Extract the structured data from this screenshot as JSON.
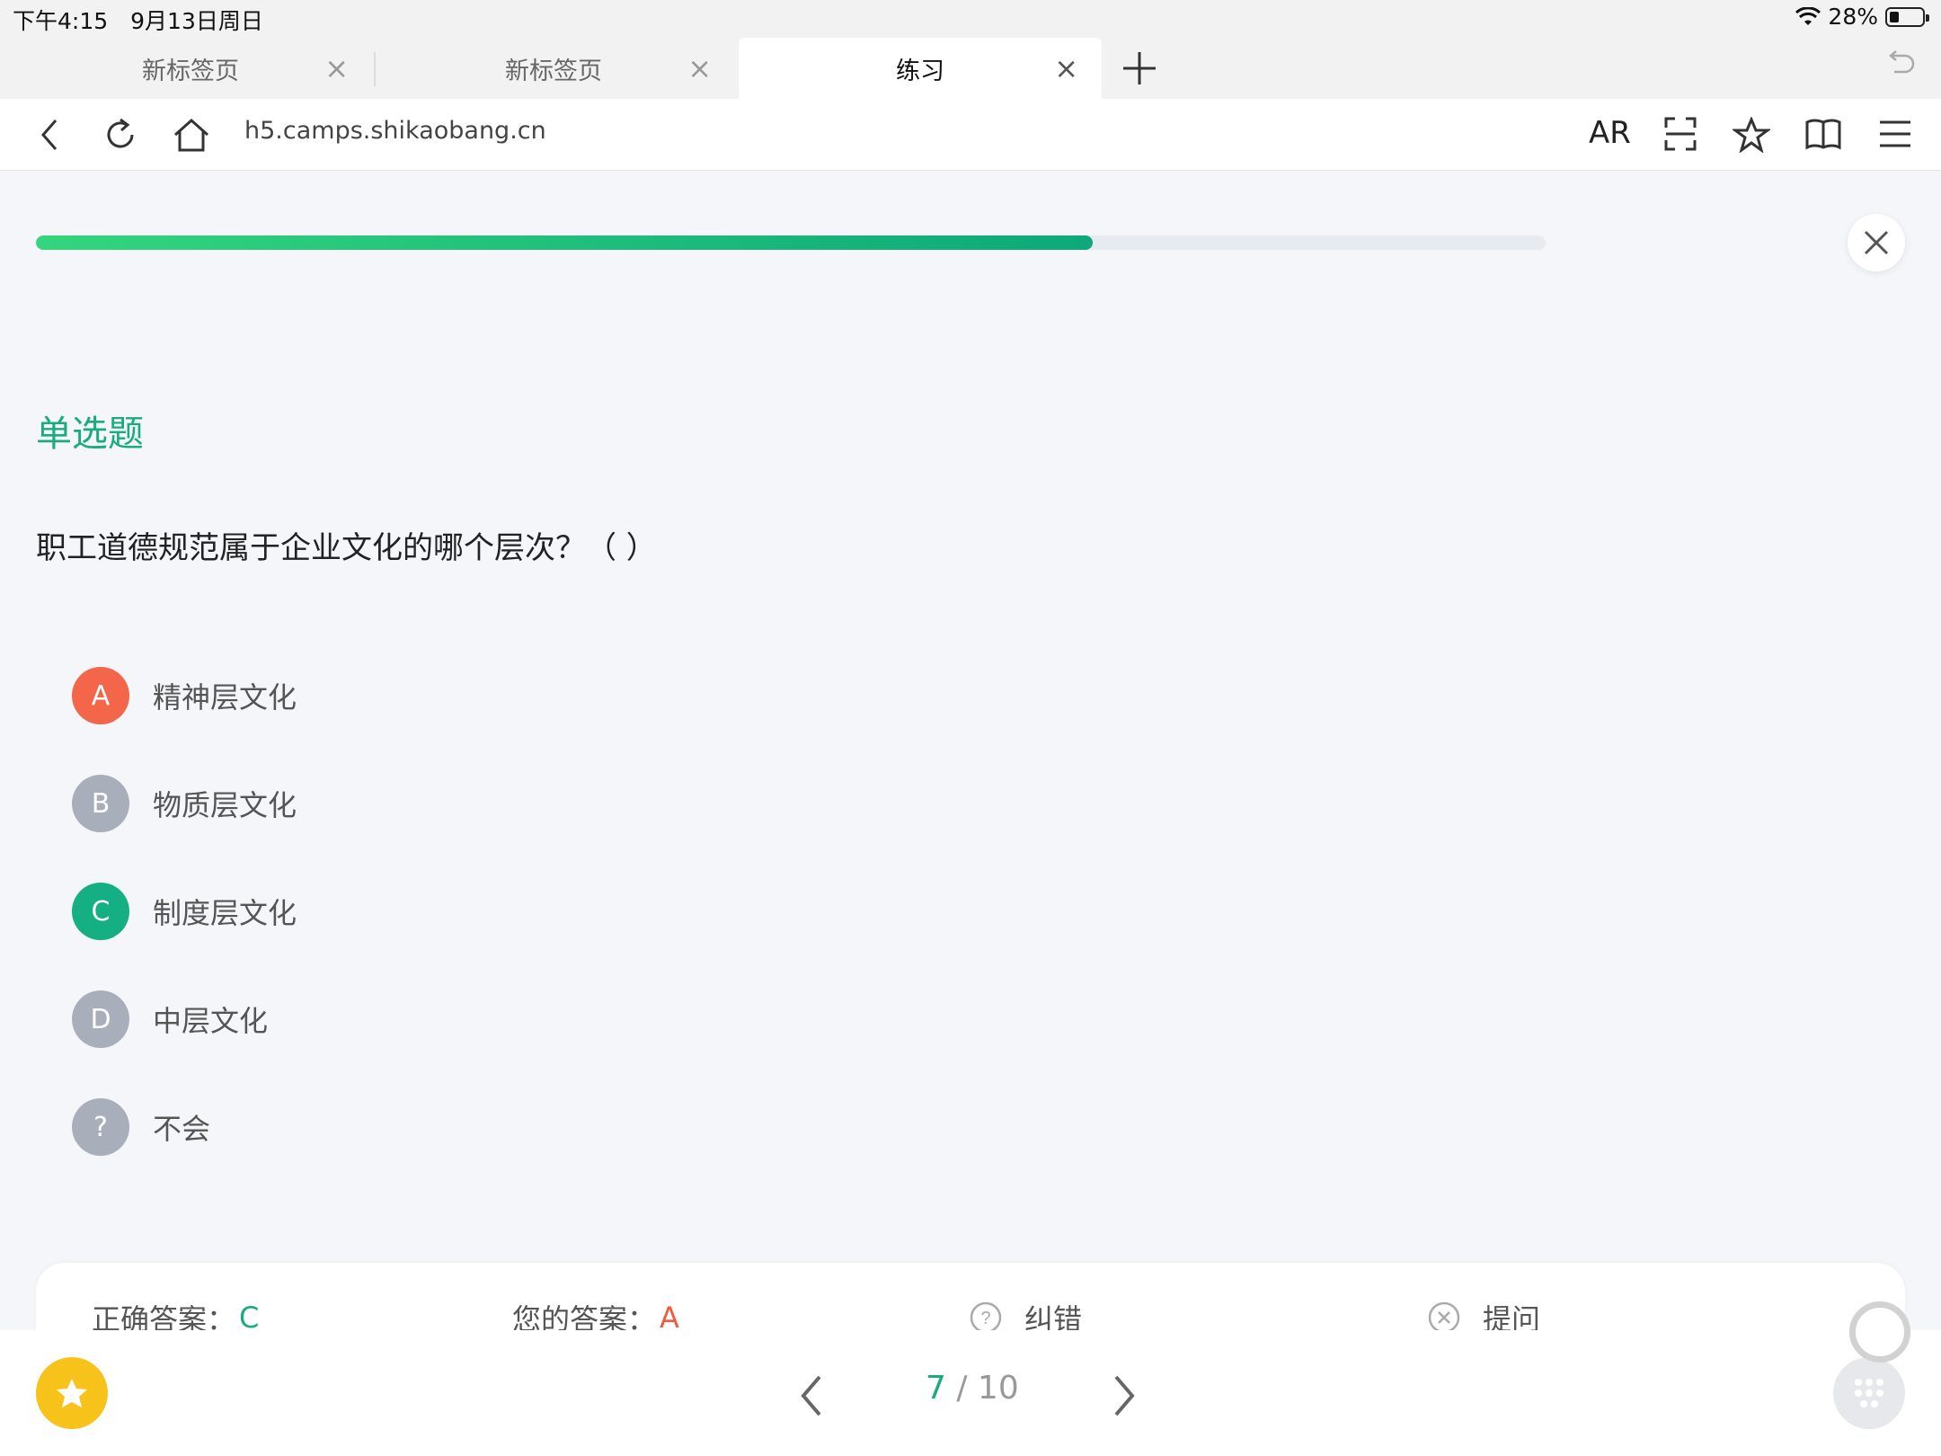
{
  "status_bar": {
    "time": "下午4:15　9月13日周日",
    "battery": "28%",
    "battery_level": 0.28
  },
  "tabs": [
    {
      "label": "新标签页",
      "active": false
    },
    {
      "label": "新标签页",
      "active": false
    },
    {
      "label": "练习",
      "active": true
    }
  ],
  "address_bar": {
    "url": "h5.camps.shikaobang.cn",
    "ar_label": "AR"
  },
  "progress": {
    "value": 0.7
  },
  "question": {
    "type_label": "单选题",
    "text": "职工道德规范属于企业文化的哪个层次？（ ）",
    "options": [
      {
        "letter": "A",
        "text": "精神层文化",
        "state": "wrong",
        "color": "#f4664a"
      },
      {
        "letter": "B",
        "text": "物质层文化",
        "state": "default",
        "color": "#a8afbb"
      },
      {
        "letter": "C",
        "text": "制度层文化",
        "state": "correct",
        "color": "#14b083"
      },
      {
        "letter": "D",
        "text": "中层文化",
        "state": "default",
        "color": "#a8afbb"
      },
      {
        "letter": "?",
        "text": "不会",
        "state": "default",
        "color": "#a8afbb"
      }
    ]
  },
  "answer_card": {
    "correct_label": "正确答案：",
    "correct_value": "C",
    "yours_label": "您的答案：",
    "yours_value": "A",
    "report_label": "纠错",
    "ask_label": "提问"
  },
  "pager": {
    "current": "7",
    "separator": " / ",
    "total": "10"
  },
  "colors": {
    "accent": "#1aab7f",
    "wrong": "#f05b3f",
    "favorite": "#f7c31b"
  }
}
